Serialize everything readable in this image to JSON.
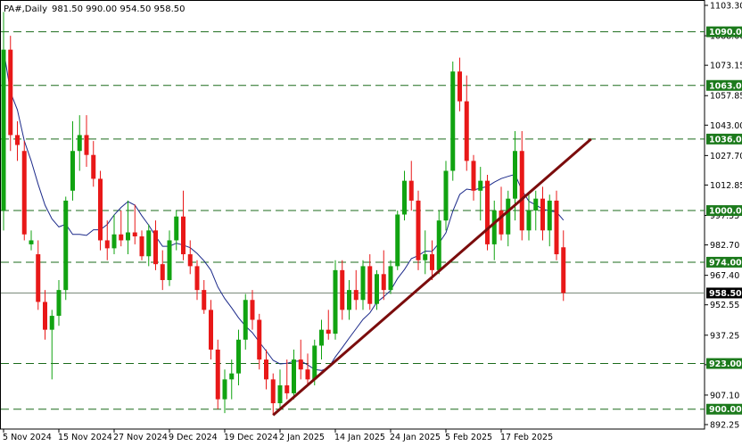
{
  "header": {
    "symbol": "PA#,Daily",
    "ohlc": "981.50 990.00 954.50 958.50"
  },
  "colors": {
    "bull": "#11a311",
    "bear": "#e81818",
    "level": "#1b6b1b",
    "level_tag": "#1c7a1c",
    "trendline": "#7b0c0c",
    "ma": "#1c2a8a",
    "current_line": "#7a8a7a",
    "current_tag": "#000000"
  },
  "chart_data": {
    "type": "candlestick",
    "interval": "Daily",
    "ylim": [
      890,
      1106
    ],
    "y_ticks": [
      "1103.30",
      "1088.00",
      "1073.15",
      "1057.85",
      "1043.00",
      "1027.70",
      "1012.85",
      "997.55",
      "982.70",
      "967.40",
      "952.55",
      "937.25",
      "922.40",
      "907.10",
      "892.25"
    ],
    "x_tick_labels": [
      "5 Nov 2024",
      "15 Nov 2024",
      "27 Nov 2024",
      "9 Dec 2024",
      "19 Dec 2024",
      "2 Jan 2025",
      "14 Jan 2025",
      "24 Jan 2025",
      "5 Feb 2025",
      "17 Feb 2025"
    ],
    "x_tick_index": [
      0,
      8,
      16,
      24,
      32,
      40,
      48,
      56,
      64,
      72
    ],
    "candles": [
      {
        "o": 1000,
        "h": 1100,
        "l": 990,
        "c": 1081
      },
      {
        "o": 1081,
        "h": 1088,
        "l": 1030,
        "c": 1038
      },
      {
        "o": 1038,
        "h": 1045,
        "l": 1025,
        "c": 1033
      },
      {
        "o": 1030,
        "h": 1035,
        "l": 985,
        "c": 988
      },
      {
        "o": 983,
        "h": 990,
        "l": 980,
        "c": 985
      },
      {
        "o": 978,
        "h": 985,
        "l": 950,
        "c": 954
      },
      {
        "o": 954,
        "h": 960,
        "l": 935,
        "c": 940
      },
      {
        "o": 940,
        "h": 950,
        "l": 915,
        "c": 947
      },
      {
        "o": 947,
        "h": 965,
        "l": 942,
        "c": 960
      },
      {
        "o": 960,
        "h": 1007,
        "l": 955,
        "c": 1005
      },
      {
        "o": 1010,
        "h": 1045,
        "l": 1005,
        "c": 1030
      },
      {
        "o": 1030,
        "h": 1048,
        "l": 1020,
        "c": 1038
      },
      {
        "o": 1038,
        "h": 1048,
        "l": 1022,
        "c": 1028
      },
      {
        "o": 1028,
        "h": 1035,
        "l": 1012,
        "c": 1016
      },
      {
        "o": 1016,
        "h": 1020,
        "l": 980,
        "c": 985
      },
      {
        "o": 985,
        "h": 995,
        "l": 975,
        "c": 981
      },
      {
        "o": 981,
        "h": 998,
        "l": 978,
        "c": 988
      },
      {
        "o": 988,
        "h": 1000,
        "l": 982,
        "c": 985
      },
      {
        "o": 985,
        "h": 1005,
        "l": 978,
        "c": 989
      },
      {
        "o": 989,
        "h": 1003,
        "l": 983,
        "c": 987
      },
      {
        "o": 987,
        "h": 990,
        "l": 975,
        "c": 977
      },
      {
        "o": 977,
        "h": 993,
        "l": 972,
        "c": 990
      },
      {
        "o": 990,
        "h": 995,
        "l": 970,
        "c": 973
      },
      {
        "o": 973,
        "h": 980,
        "l": 960,
        "c": 965
      },
      {
        "o": 965,
        "h": 990,
        "l": 962,
        "c": 985
      },
      {
        "o": 985,
        "h": 1000,
        "l": 980,
        "c": 997
      },
      {
        "o": 997,
        "h": 1010,
        "l": 975,
        "c": 978
      },
      {
        "o": 978,
        "h": 985,
        "l": 968,
        "c": 972
      },
      {
        "o": 972,
        "h": 975,
        "l": 955,
        "c": 960
      },
      {
        "o": 960,
        "h": 965,
        "l": 948,
        "c": 950
      },
      {
        "o": 950,
        "h": 955,
        "l": 925,
        "c": 930
      },
      {
        "o": 930,
        "h": 935,
        "l": 900,
        "c": 905
      },
      {
        "o": 905,
        "h": 920,
        "l": 898,
        "c": 915
      },
      {
        "o": 915,
        "h": 925,
        "l": 905,
        "c": 918
      },
      {
        "o": 918,
        "h": 940,
        "l": 912,
        "c": 935
      },
      {
        "o": 935,
        "h": 958,
        "l": 930,
        "c": 955
      },
      {
        "o": 955,
        "h": 960,
        "l": 940,
        "c": 945
      },
      {
        "o": 945,
        "h": 948,
        "l": 920,
        "c": 925
      },
      {
        "o": 925,
        "h": 930,
        "l": 910,
        "c": 915
      },
      {
        "o": 915,
        "h": 918,
        "l": 897,
        "c": 903
      },
      {
        "o": 903,
        "h": 920,
        "l": 900,
        "c": 912
      },
      {
        "o": 912,
        "h": 925,
        "l": 905,
        "c": 908
      },
      {
        "o": 908,
        "h": 930,
        "l": 905,
        "c": 925
      },
      {
        "o": 925,
        "h": 935,
        "l": 915,
        "c": 920
      },
      {
        "o": 920,
        "h": 928,
        "l": 912,
        "c": 915
      },
      {
        "o": 915,
        "h": 935,
        "l": 912,
        "c": 932
      },
      {
        "o": 932,
        "h": 945,
        "l": 925,
        "c": 940
      },
      {
        "o": 940,
        "h": 950,
        "l": 935,
        "c": 938
      },
      {
        "o": 938,
        "h": 975,
        "l": 935,
        "c": 970
      },
      {
        "o": 970,
        "h": 975,
        "l": 945,
        "c": 950
      },
      {
        "o": 950,
        "h": 965,
        "l": 945,
        "c": 960
      },
      {
        "o": 960,
        "h": 970,
        "l": 950,
        "c": 955
      },
      {
        "o": 955,
        "h": 975,
        "l": 950,
        "c": 972
      },
      {
        "o": 972,
        "h": 978,
        "l": 950,
        "c": 953
      },
      {
        "o": 953,
        "h": 970,
        "l": 950,
        "c": 968
      },
      {
        "o": 968,
        "h": 980,
        "l": 955,
        "c": 960
      },
      {
        "o": 960,
        "h": 975,
        "l": 958,
        "c": 972
      },
      {
        "o": 972,
        "h": 1000,
        "l": 970,
        "c": 998
      },
      {
        "o": 998,
        "h": 1020,
        "l": 995,
        "c": 1015
      },
      {
        "o": 1015,
        "h": 1025,
        "l": 1000,
        "c": 1005
      },
      {
        "o": 1005,
        "h": 1010,
        "l": 970,
        "c": 975
      },
      {
        "o": 975,
        "h": 990,
        "l": 968,
        "c": 978
      },
      {
        "o": 978,
        "h": 985,
        "l": 965,
        "c": 970
      },
      {
        "o": 970,
        "h": 1000,
        "l": 968,
        "c": 995
      },
      {
        "o": 995,
        "h": 1025,
        "l": 990,
        "c": 1020
      },
      {
        "o": 1020,
        "h": 1075,
        "l": 1015,
        "c": 1070
      },
      {
        "o": 1070,
        "h": 1077,
        "l": 1050,
        "c": 1055
      },
      {
        "o": 1055,
        "h": 1068,
        "l": 1020,
        "c": 1025
      },
      {
        "o": 1025,
        "h": 1028,
        "l": 1005,
        "c": 1010
      },
      {
        "o": 1010,
        "h": 1022,
        "l": 995,
        "c": 1015
      },
      {
        "o": 1015,
        "h": 1018,
        "l": 980,
        "c": 983
      },
      {
        "o": 983,
        "h": 1005,
        "l": 975,
        "c": 1000
      },
      {
        "o": 1000,
        "h": 1012,
        "l": 985,
        "c": 988
      },
      {
        "o": 988,
        "h": 1010,
        "l": 982,
        "c": 1006
      },
      {
        "o": 1006,
        "h": 1040,
        "l": 995,
        "c": 1030
      },
      {
        "o": 1030,
        "h": 1040,
        "l": 985,
        "c": 990
      },
      {
        "o": 990,
        "h": 1008,
        "l": 985,
        "c": 1000
      },
      {
        "o": 1000,
        "h": 1010,
        "l": 990,
        "c": 1006
      },
      {
        "o": 1006,
        "h": 1012,
        "l": 985,
        "c": 990
      },
      {
        "o": 990,
        "h": 1008,
        "l": 982,
        "c": 1005
      },
      {
        "o": 1005,
        "h": 1010,
        "l": 975,
        "c": 978
      },
      {
        "o": 981.5,
        "h": 990,
        "l": 954.5,
        "c": 958.5
      }
    ],
    "ma_period": 10,
    "levels": [
      {
        "value": 1090,
        "label": "1090.00"
      },
      {
        "value": 1063,
        "label": "1063.00"
      },
      {
        "value": 1036,
        "label": "1036.00"
      },
      {
        "value": 1000,
        "label": "1000.00"
      },
      {
        "value": 974,
        "label": "974.00"
      },
      {
        "value": 923,
        "label": "923.00"
      },
      {
        "value": 900,
        "label": "900.00"
      }
    ],
    "current_price": {
      "value": 958.5,
      "label": "958.50"
    },
    "trendline": {
      "x1": 39,
      "y1": 897,
      "x2": 85,
      "y2": 1036
    }
  }
}
